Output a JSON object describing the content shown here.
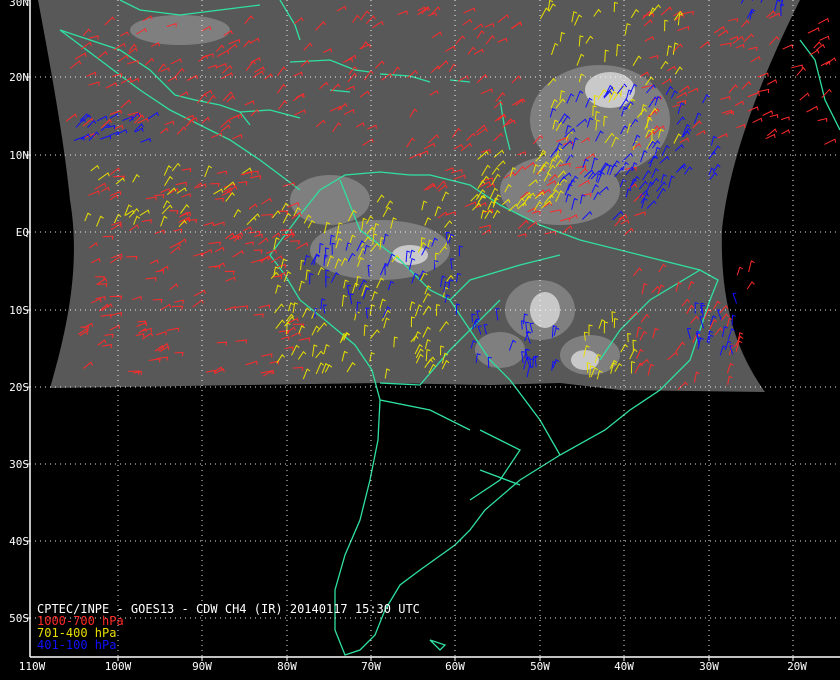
{
  "title": "CPTEC/INPE - GOES13 - CDW CH4 (IR) 20140117 15:30 UTC",
  "legend": [
    {
      "label": "1000-700 hPa",
      "color": "#ff2a2a"
    },
    {
      "label": "701-400 hPa",
      "color": "#e8e000"
    },
    {
      "label": "401-100 hPa",
      "color": "#1010ff"
    }
  ],
  "colors": {
    "coastline": "#30e0a0",
    "grid": "#ffffff",
    "background": "#000000",
    "satellite": "#5a5a5a"
  },
  "lat_labels": [
    "30N",
    "20N",
    "10N",
    "EQ",
    "10S",
    "20S",
    "30S",
    "40S",
    "50S"
  ],
  "lon_labels": [
    "110W",
    "100W",
    "90W",
    "80W",
    "70W",
    "60W",
    "50W",
    "40W",
    "30W",
    "20W"
  ]
}
